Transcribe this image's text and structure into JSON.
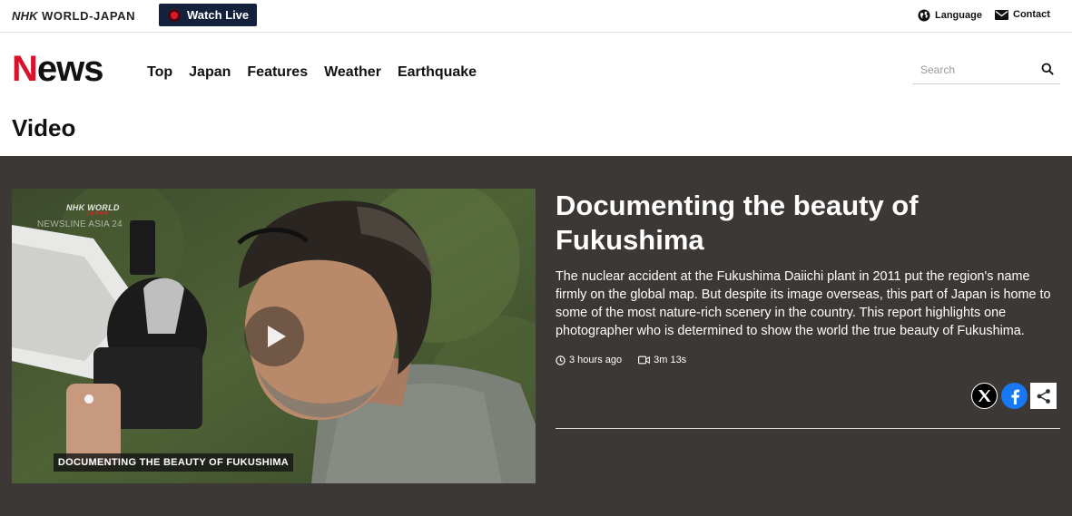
{
  "topbar": {
    "brand_nhk": "NHK",
    "brand_rest": "WORLD-JAPAN",
    "watch_live": "Watch Live",
    "language": "Language",
    "contact": "Contact"
  },
  "header": {
    "logo_n": "N",
    "logo_rest": "ews",
    "nav": [
      "Top",
      "Japan",
      "Features",
      "Weather",
      "Earthquake"
    ],
    "search_placeholder": "Search"
  },
  "page_title": "Video",
  "feature": {
    "video": {
      "watermark_brand": "NHK WORLD",
      "watermark_sub": "JAPAN",
      "watermark_program": "NEWSLINE ASIA 24",
      "caption": "DOCUMENTING THE BEAUTY OF FUKUSHIMA"
    },
    "headline": "Documenting the beauty of Fukushima",
    "description": "The nuclear accident at the Fukushima Daiichi plant in 2011 put the region's name firmly on the global map. But despite its image overseas, this part of Japan is home to some of the most nature-rich scenery in the country. This report highlights one photographer who is determined to show the world the true beauty of Fukushima.",
    "time_ago": "3 hours ago",
    "duration": "3m 13s"
  },
  "colors": {
    "brand_red": "#d7122a",
    "watch_live_bg": "#14213d",
    "feature_bg": "#3b3836",
    "facebook": "#1877f2"
  },
  "icons": [
    "live-dot-icon",
    "globe-icon",
    "mail-icon",
    "search-icon",
    "play-icon",
    "clock-icon",
    "video-camera-icon",
    "x-logo-icon",
    "facebook-icon",
    "share-icon"
  ]
}
